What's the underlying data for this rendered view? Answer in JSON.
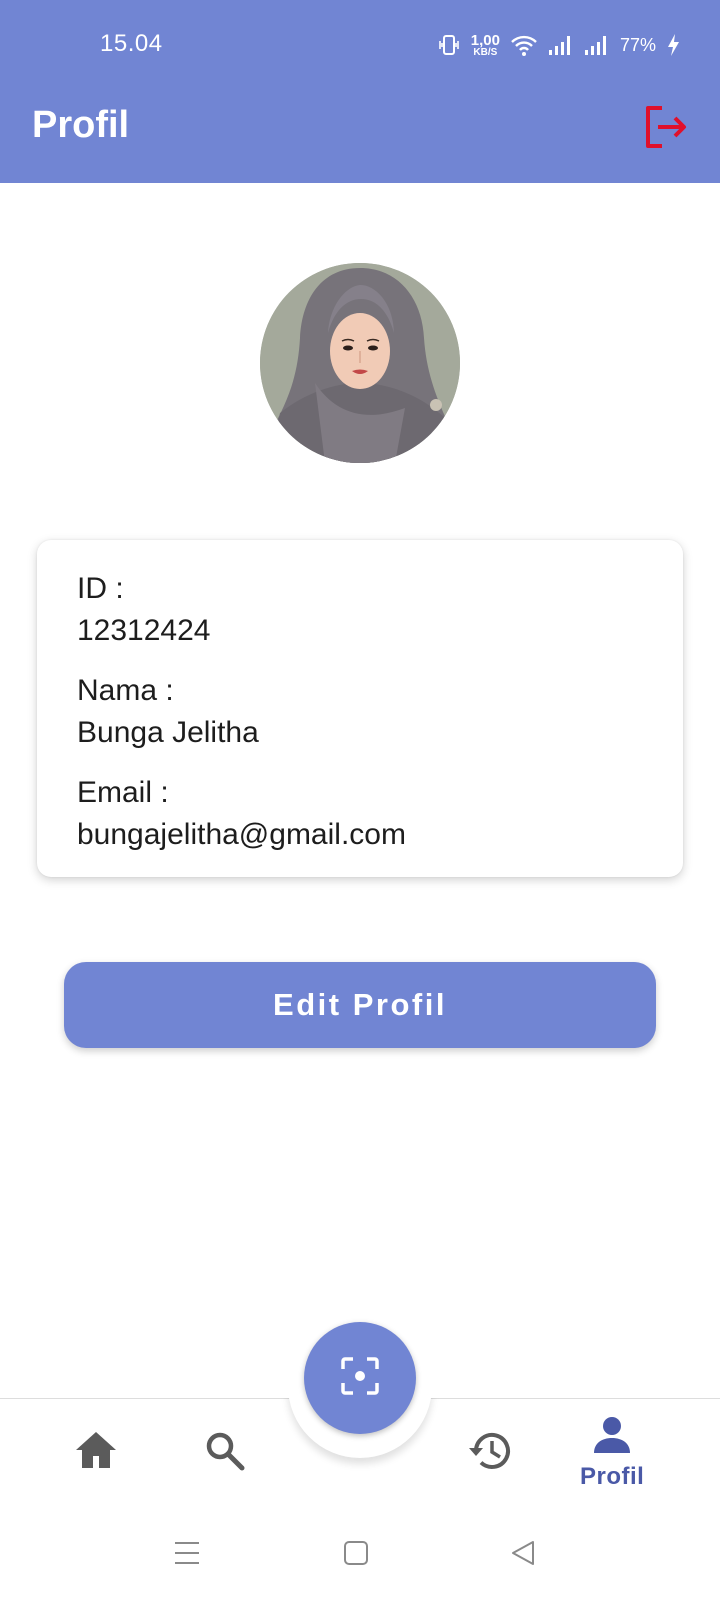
{
  "status_bar": {
    "time": "15.04",
    "net_speed_value": "1,00",
    "net_speed_unit": "KB/S",
    "battery": "77%",
    "icons": [
      "vibrate-icon",
      "wifi-icon",
      "signal-icon",
      "signal-icon",
      "charging-icon"
    ]
  },
  "header": {
    "title": "Profil",
    "logout_icon": "logout-icon"
  },
  "profile": {
    "id_label": "ID :",
    "id_value": "12312424",
    "name_label": "Nama :",
    "name_value": "Bunga Jelitha",
    "email_label": "Email :",
    "email_value": "bungajelitha@gmail.com"
  },
  "actions": {
    "edit_label": "Edit Profil"
  },
  "bottom_nav": {
    "items": [
      {
        "icon": "home-icon"
      },
      {
        "icon": "search-icon"
      },
      {
        "icon": "scan-icon"
      },
      {
        "icon": "history-icon"
      },
      {
        "icon": "person-icon",
        "label": "Profil"
      }
    ],
    "active": "Profil"
  },
  "colors": {
    "primary": "#7185d3",
    "active_nav": "#4a59a7",
    "logout": "#e0102b",
    "text": "#1d1d1d"
  }
}
